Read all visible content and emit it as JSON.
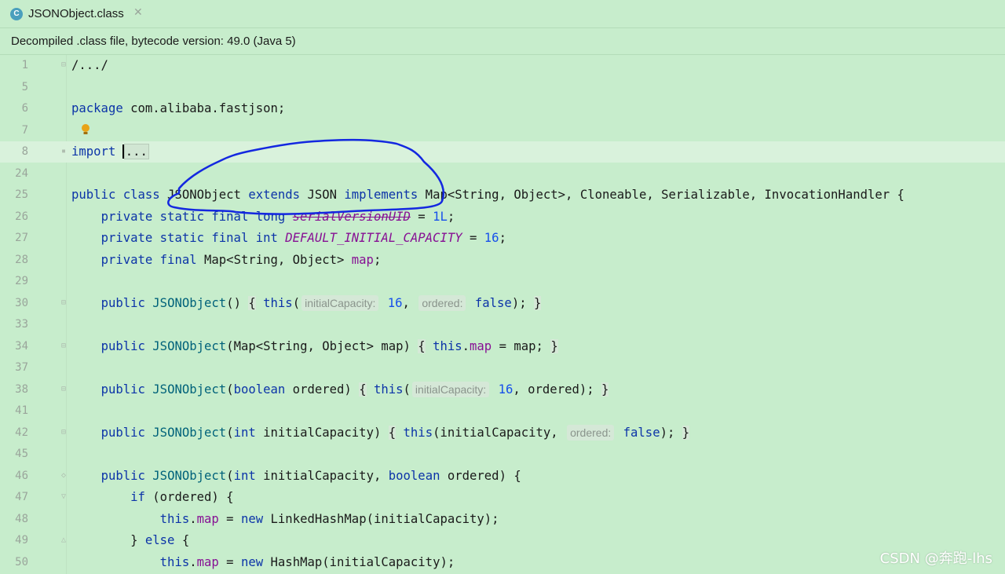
{
  "tab": {
    "icon_letter": "C",
    "title": "JSONObject.class",
    "close": "✕"
  },
  "banner": {
    "text": "Decompiled .class file, bytecode version: 49.0 (Java 5)"
  },
  "lines": [
    {
      "num": "1",
      "segs": [
        {
          "t": "/.../"
        }
      ]
    },
    {
      "num": "5",
      "segs": []
    },
    {
      "num": "6",
      "segs": [
        {
          "t": "package",
          "c": "kw"
        },
        {
          "t": " com.alibaba.fastjson;"
        }
      ]
    },
    {
      "num": "7",
      "segs": []
    },
    {
      "num": "8",
      "current": true,
      "segs": [
        {
          "t": "import",
          "c": "kw"
        },
        {
          "t": " "
        },
        {
          "t": "",
          "c": "caret"
        },
        {
          "t": "...",
          "c": "folded"
        }
      ]
    },
    {
      "num": "24",
      "segs": []
    },
    {
      "num": "25",
      "segs": [
        {
          "t": "public class",
          "c": "kw"
        },
        {
          "t": " JSONObject "
        },
        {
          "t": "extends",
          "c": "kw"
        },
        {
          "t": " JSON "
        },
        {
          "t": "implements",
          "c": "kw"
        },
        {
          "t": " Map<String, Object>, Cloneable, Serializable, InvocationHandler {"
        }
      ]
    },
    {
      "num": "26",
      "segs": [
        {
          "t": "    "
        },
        {
          "t": "private static final long",
          "c": "kw"
        },
        {
          "t": " "
        },
        {
          "t": "serialVersionUID",
          "c": "sfld dep"
        },
        {
          "t": " = "
        },
        {
          "t": "1L",
          "c": "num"
        },
        {
          "t": ";"
        }
      ]
    },
    {
      "num": "27",
      "segs": [
        {
          "t": "    "
        },
        {
          "t": "private static final int",
          "c": "kw"
        },
        {
          "t": " "
        },
        {
          "t": "DEFAULT_INITIAL_CAPACITY",
          "c": "sfld"
        },
        {
          "t": " = "
        },
        {
          "t": "16",
          "c": "num"
        },
        {
          "t": ";"
        }
      ]
    },
    {
      "num": "28",
      "segs": [
        {
          "t": "    "
        },
        {
          "t": "private final",
          "c": "kw"
        },
        {
          "t": " Map<String, Object> "
        },
        {
          "t": "map",
          "c": "fld"
        },
        {
          "t": ";"
        }
      ]
    },
    {
      "num": "29",
      "segs": []
    },
    {
      "num": "30",
      "segs": [
        {
          "t": "    "
        },
        {
          "t": "public",
          "c": "kw"
        },
        {
          "t": " "
        },
        {
          "t": "JSONObject",
          "c": "fn"
        },
        {
          "t": "() "
        },
        {
          "t": "{",
          "c": "brace-hl"
        },
        {
          "t": " "
        },
        {
          "t": "this",
          "c": "kw"
        },
        {
          "t": "("
        },
        {
          "t": "initialCapacity:",
          "c": "hint"
        },
        {
          "t": " "
        },
        {
          "t": "16",
          "c": "num"
        },
        {
          "t": ", "
        },
        {
          "t": "ordered:",
          "c": "hint"
        },
        {
          "t": " "
        },
        {
          "t": "false",
          "c": "kw"
        },
        {
          "t": "); "
        },
        {
          "t": "}",
          "c": "brace-hl"
        }
      ]
    },
    {
      "num": "33",
      "segs": []
    },
    {
      "num": "34",
      "segs": [
        {
          "t": "    "
        },
        {
          "t": "public",
          "c": "kw"
        },
        {
          "t": " "
        },
        {
          "t": "JSONObject",
          "c": "fn"
        },
        {
          "t": "(Map<String, Object> map) "
        },
        {
          "t": "{",
          "c": "brace-hl"
        },
        {
          "t": " "
        },
        {
          "t": "this",
          "c": "kw"
        },
        {
          "t": "."
        },
        {
          "t": "map",
          "c": "fld"
        },
        {
          "t": " = map; "
        },
        {
          "t": "}",
          "c": "brace-hl"
        }
      ]
    },
    {
      "num": "37",
      "segs": []
    },
    {
      "num": "38",
      "segs": [
        {
          "t": "    "
        },
        {
          "t": "public",
          "c": "kw"
        },
        {
          "t": " "
        },
        {
          "t": "JSONObject",
          "c": "fn"
        },
        {
          "t": "("
        },
        {
          "t": "boolean",
          "c": "kw"
        },
        {
          "t": " ordered) "
        },
        {
          "t": "{",
          "c": "brace-hl"
        },
        {
          "t": " "
        },
        {
          "t": "this",
          "c": "kw"
        },
        {
          "t": "("
        },
        {
          "t": "initialCapacity:",
          "c": "hint"
        },
        {
          "t": " "
        },
        {
          "t": "16",
          "c": "num"
        },
        {
          "t": ", ordered); "
        },
        {
          "t": "}",
          "c": "brace-hl"
        }
      ]
    },
    {
      "num": "41",
      "segs": []
    },
    {
      "num": "42",
      "segs": [
        {
          "t": "    "
        },
        {
          "t": "public",
          "c": "kw"
        },
        {
          "t": " "
        },
        {
          "t": "JSONObject",
          "c": "fn"
        },
        {
          "t": "("
        },
        {
          "t": "int",
          "c": "kw"
        },
        {
          "t": " initialCapacity) "
        },
        {
          "t": "{",
          "c": "brace-hl"
        },
        {
          "t": " "
        },
        {
          "t": "this",
          "c": "kw"
        },
        {
          "t": "(initialCapacity, "
        },
        {
          "t": "ordered:",
          "c": "hint"
        },
        {
          "t": " "
        },
        {
          "t": "false",
          "c": "kw"
        },
        {
          "t": "); "
        },
        {
          "t": "}",
          "c": "brace-hl"
        }
      ]
    },
    {
      "num": "45",
      "segs": []
    },
    {
      "num": "46",
      "segs": [
        {
          "t": "    "
        },
        {
          "t": "public",
          "c": "kw"
        },
        {
          "t": " "
        },
        {
          "t": "JSONObject",
          "c": "fn"
        },
        {
          "t": "("
        },
        {
          "t": "int",
          "c": "kw"
        },
        {
          "t": " initialCapacity, "
        },
        {
          "t": "boolean",
          "c": "kw"
        },
        {
          "t": " ordered) {"
        }
      ]
    },
    {
      "num": "47",
      "segs": [
        {
          "t": "        "
        },
        {
          "t": "if",
          "c": "kw"
        },
        {
          "t": " (ordered) {"
        }
      ]
    },
    {
      "num": "48",
      "segs": [
        {
          "t": "            "
        },
        {
          "t": "this",
          "c": "kw"
        },
        {
          "t": "."
        },
        {
          "t": "map",
          "c": "fld"
        },
        {
          "t": " = "
        },
        {
          "t": "new",
          "c": "kw"
        },
        {
          "t": " LinkedHashMap(initialCapacity);"
        }
      ]
    },
    {
      "num": "49",
      "segs": [
        {
          "t": "        } "
        },
        {
          "t": "else",
          "c": "kw"
        },
        {
          "t": " {"
        }
      ]
    },
    {
      "num": "50",
      "segs": [
        {
          "t": "            "
        },
        {
          "t": "this",
          "c": "kw"
        },
        {
          "t": "."
        },
        {
          "t": "map",
          "c": "fld"
        },
        {
          "t": " = "
        },
        {
          "t": "new",
          "c": "kw"
        },
        {
          "t": " HashMap(initialCapacity);"
        }
      ]
    }
  ],
  "watermark": "CSDN @奔跑-lhs",
  "colors": {
    "background": "#c7edcc",
    "keyword": "#0c34a8",
    "field": "#871094",
    "number": "#1750eb",
    "annotation_ink": "#1428e0"
  }
}
